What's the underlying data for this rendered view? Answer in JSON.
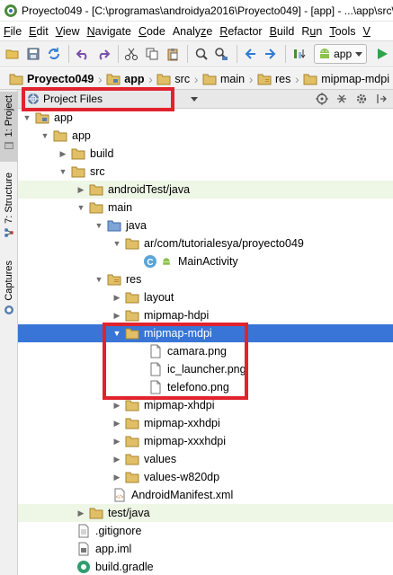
{
  "window": {
    "title": "Proyecto049 - [C:\\programas\\androidya2016\\Proyecto049] - [app] - ...\\app\\src\\"
  },
  "menu": [
    {
      "u": "F",
      "rest": "ile"
    },
    {
      "u": "E",
      "rest": "dit"
    },
    {
      "u": "V",
      "rest": "iew"
    },
    {
      "u": "N",
      "rest": "avigate"
    },
    {
      "u": "C",
      "rest": "ode"
    },
    {
      "u": "",
      "rest": "Analy",
      "u2": "z",
      "rest2": "e"
    },
    {
      "u": "R",
      "rest": "efactor"
    },
    {
      "u": "B",
      "rest": "uild"
    },
    {
      "u": "",
      "rest": "R",
      "u2": "u",
      "rest2": "n"
    },
    {
      "u": "",
      "rest": "",
      "u2": "T",
      "rest2": "ools"
    },
    {
      "u": "V",
      "rest": ""
    }
  ],
  "toolbar": {
    "run_config": "app"
  },
  "breadcrumb": [
    "Proyecto049",
    "app",
    "src",
    "main",
    "res",
    "mipmap-mdpi"
  ],
  "sidebar": {
    "project_tab": "1: Project",
    "structure_tab": "7: Structure",
    "captures_tab": "Captures"
  },
  "panel": {
    "view_mode": "Project Files"
  },
  "tree": [
    {
      "label": "app",
      "expanded": true
    },
    {
      "label": "app",
      "expanded": true
    },
    {
      "label": "build",
      "expanded": false
    },
    {
      "label": "src",
      "expanded": true
    },
    {
      "label": "androidTest/java",
      "expanded": false
    },
    {
      "label": "main",
      "expanded": true
    },
    {
      "label": "java",
      "expanded": true
    },
    {
      "label": "ar/com/tutorialesya/proyecto049",
      "expanded": true
    },
    {
      "label": "MainActivity"
    },
    {
      "label": "res",
      "expanded": true
    },
    {
      "label": "layout",
      "expanded": false
    },
    {
      "label": "mipmap-hdpi",
      "expanded": false
    },
    {
      "label": "mipmap-mdpi",
      "expanded": true
    },
    {
      "label": "camara.png"
    },
    {
      "label": "ic_launcher.png"
    },
    {
      "label": "telefono.png"
    },
    {
      "label": "mipmap-xhdpi",
      "expanded": false
    },
    {
      "label": "mipmap-xxhdpi",
      "expanded": false
    },
    {
      "label": "mipmap-xxxhdpi",
      "expanded": false
    },
    {
      "label": "values",
      "expanded": false
    },
    {
      "label": "values-w820dp",
      "expanded": false
    },
    {
      "label": "AndroidManifest.xml"
    },
    {
      "label": "test/java",
      "expanded": false
    },
    {
      "label": ".gitignore"
    },
    {
      "label": "app.iml"
    },
    {
      "label": "build.gradle"
    }
  ],
  "colors": {
    "selection": "#3875d7",
    "highlight_box": "#e0232d",
    "test_folder_bg": "#eef6e6"
  },
  "icons": {
    "toolbar": [
      "open-folder-icon",
      "save-icon",
      "sync-icon",
      "undo-icon",
      "redo-icon",
      "cut-icon",
      "copy-icon",
      "paste-icon",
      "find-icon",
      "replace-icon",
      "back-icon",
      "forward-icon",
      "make-project-icon",
      "android-icon",
      "run-icon"
    ],
    "panel": [
      "target-icon",
      "collapse-icon",
      "settings-icon",
      "hide-icon"
    ]
  }
}
